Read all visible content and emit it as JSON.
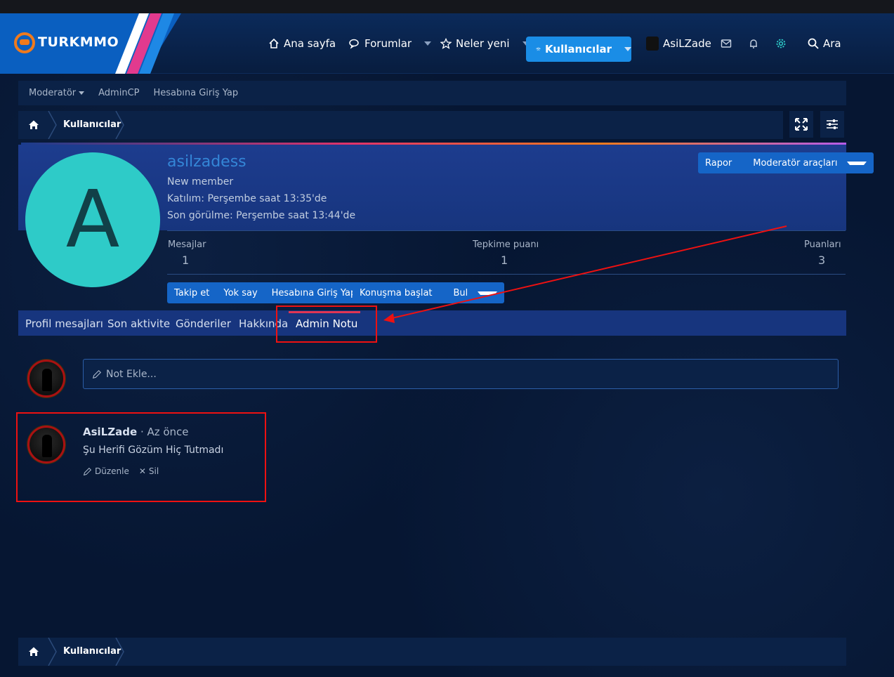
{
  "brand": {
    "name": "TURKMMO"
  },
  "nav": {
    "home": "Ana sayfa",
    "forums": "Forumlar",
    "whats_new": "Neler yeni",
    "members": "Kullanıcılar",
    "user": "AsiLZade",
    "search": "Ara"
  },
  "subnav": {
    "moderator": "Moderatör",
    "admincp": "AdminCP",
    "login_as": "Hesabına Giriş Yap"
  },
  "breadcrumb": {
    "current": "Kullanıcılar"
  },
  "profile": {
    "avatar_letter": "A",
    "username": "asilzadess",
    "title": "New member",
    "joined": "Katılım: Perşembe saat 13:35'de",
    "last_seen": "Son görülme: Perşembe saat 13:44'de",
    "report": "Rapor",
    "mod_tools": "Moderatör araçları",
    "stats": [
      {
        "label": "Mesajlar",
        "value": "1"
      },
      {
        "label": "Tepkime puanı",
        "value": "1"
      },
      {
        "label": "Puanları",
        "value": "3"
      }
    ],
    "actions": {
      "follow": "Takip et",
      "ignore": "Yok say",
      "login_as": "Hesabına Giriş Yap"
    },
    "actions2": {
      "start_conv": "Konuşma başlat",
      "find": "Bul"
    }
  },
  "tabs": [
    "Profil mesajları",
    "Son aktivite",
    "Gönderiler",
    "Hakkında",
    "Admin Notu"
  ],
  "note_input": {
    "placeholder": "Not Ekle..."
  },
  "note": {
    "author": "AsiLZade",
    "time": "· Az önce",
    "text": "Şu Herifi Gözüm Hiç Tutmadı",
    "edit": "Düzenle",
    "delete": "Sil"
  },
  "colors": {
    "accent": "#1a8de6",
    "highlight": "#e11111",
    "avatar_bg": "#2ecbc8"
  }
}
